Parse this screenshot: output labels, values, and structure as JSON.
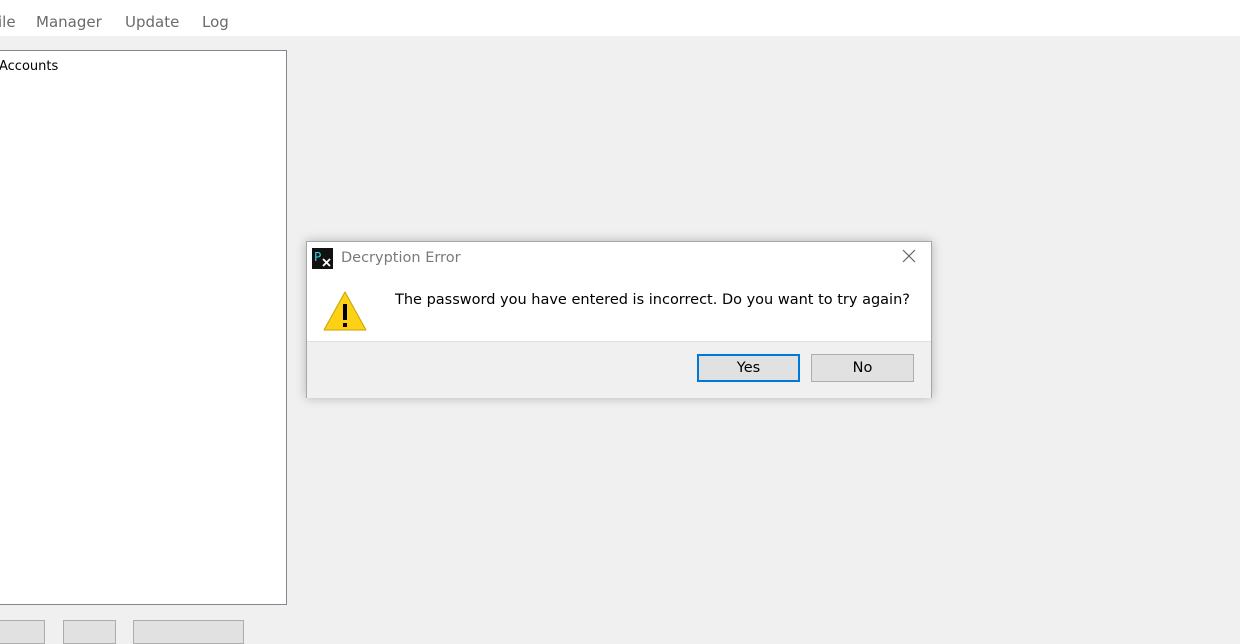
{
  "menu": {
    "items": [
      {
        "label": "ile"
      },
      {
        "label": "Manager"
      },
      {
        "label": "Update"
      },
      {
        "label": "Log"
      }
    ]
  },
  "tree": {
    "root_label": "Accounts"
  },
  "dialog": {
    "app_icon": "px-app-icon",
    "title": "Decryption Error",
    "close_icon": "close-icon",
    "warning_icon": "warning-icon",
    "message": "The password you have entered is incorrect. Do you want to try again?",
    "yes_label": "Yes",
    "no_label": "No"
  },
  "colors": {
    "accent": "#0078d7",
    "warning": "#fcd116"
  }
}
